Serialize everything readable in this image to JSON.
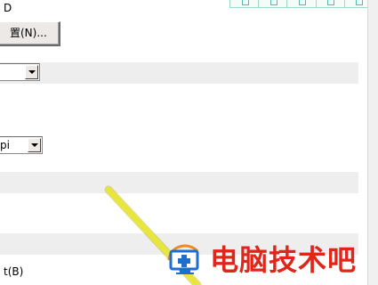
{
  "top_fragment": "D",
  "settings_button": {
    "label": "置(N)..."
  },
  "dropdown_1": {
    "value": ""
  },
  "dropdown_2": {
    "value": "pi"
  },
  "bottom_fragment": "t(B)",
  "watermark": {
    "text": "电脑技术吧",
    "icon": "monitor-plus-icon"
  },
  "top_toolbar": {
    "cells": 5
  },
  "colors": {
    "band": "#eeeeee",
    "watermark_red": "#e0251b",
    "stroke_yellow": "#e8e63a"
  }
}
